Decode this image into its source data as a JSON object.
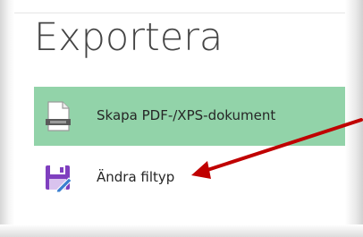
{
  "panel": {
    "title": "Exportera"
  },
  "items": [
    {
      "label": "Skapa PDF-/XPS-dokument",
      "icon": "pdf-document-icon",
      "selected": true
    },
    {
      "label": "Ändra filtyp",
      "icon": "save-as-floppy-icon",
      "selected": false
    }
  ],
  "colors": {
    "selected_bg": "#92d3a9",
    "annotation_arrow": "#c00000",
    "floppy_accent": "#7f3fbf"
  }
}
